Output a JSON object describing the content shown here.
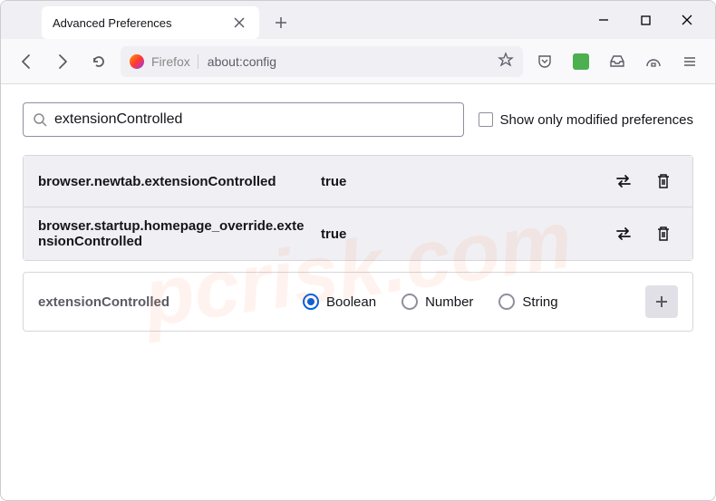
{
  "window": {
    "tab_title": "Advanced Preferences"
  },
  "addressbar": {
    "brand": "Firefox",
    "url": "about:config"
  },
  "search": {
    "value": "extensionControlled",
    "checkbox_label": "Show only modified preferences"
  },
  "results": [
    {
      "name": "browser.newtab.extensionControlled",
      "value": "true"
    },
    {
      "name": "browser.startup.homepage_override.extensionControlled",
      "value": "true"
    }
  ],
  "new_pref": {
    "name": "extensionControlled",
    "types": [
      "Boolean",
      "Number",
      "String"
    ],
    "selected": "Boolean"
  },
  "watermark": "pcrisk.com"
}
